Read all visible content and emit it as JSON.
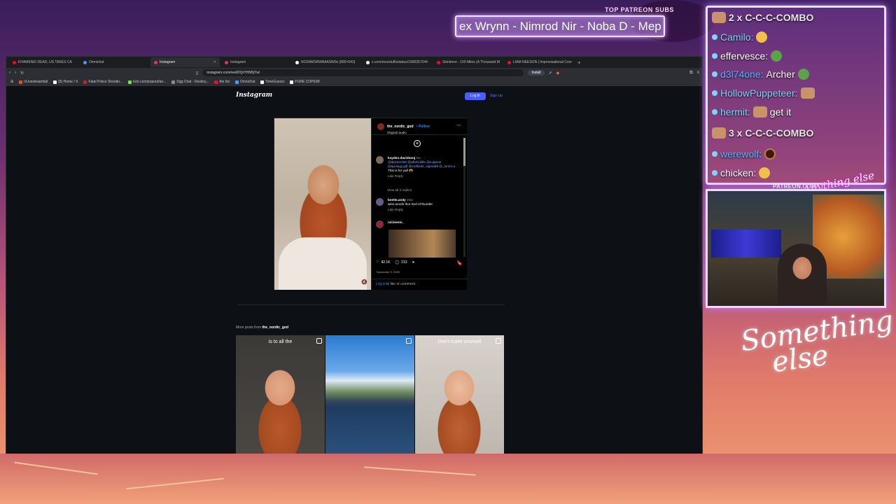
{
  "overlay": {
    "patreon_header": "TOP PATREON SUBS",
    "patreon_ticker": "ex Wrynn - Nimrod Nir - Noba D - Mep",
    "patreon_url": "PATREON.COM/",
    "anything_text": "Anything else",
    "signature_line1": "Something",
    "signature_line2": "else"
  },
  "browser": {
    "tabs": [
      {
        "label": "KHAMENEI DEAD, US TAKES CA",
        "color": "#ff0033"
      },
      {
        "label": "Omnichat",
        "color": "#3aa0ff"
      },
      {
        "label": "Instagram",
        "color": "#e1306c",
        "active": true
      },
      {
        "label": "Instagram",
        "color": "#e1306c"
      },
      {
        "label": "NCRAMSRWAAASW0s (890×543)",
        "color": "#ffffff"
      },
      {
        "label": "x.com/rezzstuffs/status/1990357244",
        "color": "#ffffff"
      },
      {
        "label": "Skinlerne - 100 Miles (A Thousand M",
        "color": "#ff0033"
      },
      {
        "label": "LIAM NEESON | Improvisational Com",
        "color": "#ff0033"
      }
    ],
    "new_tab_icon": "+",
    "url": "instagram.com/reel/DQrYHN5jYw/",
    "install_label": "Install",
    "bookmarks": [
      {
        "label": "r/Livestreamfail",
        "color": "#ff4500"
      },
      {
        "label": "(5) Home / X",
        "color": "#ffffff"
      },
      {
        "label": "Fatal Police Shootin...",
        "color": "#ff0033"
      },
      {
        "label": "kick.com/popout/an...",
        "color": "#53fc18"
      },
      {
        "label": "Dgg Chat - Destiny...",
        "color": "#8a8a8a"
      },
      {
        "label": "the list",
        "color": "#ff0033"
      },
      {
        "label": "Omnichat",
        "color": "#3aa0ff"
      },
      {
        "label": "TimeGuessr",
        "color": "#ffffff"
      },
      {
        "label": "PURE COPIUM",
        "color": "#ffffff"
      }
    ]
  },
  "instagram": {
    "logo": "Instagram",
    "login_label": "Log In",
    "signup_label": "Sign Up",
    "post": {
      "username": "the_nordic_god",
      "follow": "• Follow",
      "audio": "Original audio",
      "comments": [
        {
          "user": "kayden.davidsonj",
          "time": "6w",
          "mentions": "@dp4mn320 @villvrickille @a.pipme @apology.gdl @cutflavle_sigma69 @_lorinn.a",
          "text": "This is for yall 🫶",
          "actions": "Like   Reply",
          "avatar_color": "#7a6b5a"
        },
        {
          "user": "beetle.andy",
          "time": "16w",
          "text": "wise words thor lord of thunder",
          "actions": "Like   Reply",
          "avatar_color": "#6a5a8a"
        },
        {
          "user": "ral.leenin_",
          "avatar_color": "#8a2a3a"
        }
      ],
      "view_replies": "View all 3 replies",
      "likes": "42.1K",
      "comments_count": "213",
      "date": "November 3, 2025",
      "login_prompt_link": "Log in",
      "login_prompt_rest": " to like or comment."
    },
    "more_posts_prefix": "More posts from ",
    "more_posts_user": "the_nordic_god",
    "grid": [
      {
        "caption": "is to all the"
      },
      {
        "caption": ""
      },
      {
        "caption": "Don't make yourself"
      }
    ]
  },
  "chat": {
    "messages": [
      {
        "user": "",
        "text": "2 x C-C-C-COMBO",
        "type": "combo"
      },
      {
        "user": "Camilo:",
        "text": "",
        "user_color": "#7ad6ff"
      },
      {
        "user": "effervesce:",
        "text": "",
        "user_color": "#ffffff"
      },
      {
        "user": "d3l74one:",
        "text": "Archer",
        "user_color": "#5fb4ff"
      },
      {
        "user": "HollowPuppeteer:",
        "text": "",
        "user_color": "#7ad6ff"
      },
      {
        "user": "hermit:",
        "text": "get it",
        "user_color": "#7ad6ff"
      },
      {
        "user": "",
        "text": "3 x C-C-C-COMBO",
        "type": "combo"
      },
      {
        "user": "werewolf:",
        "text": "",
        "user_color": "#5fb4ff"
      },
      {
        "user": "chicken:",
        "text": "",
        "user_color": "#ffffff"
      }
    ]
  }
}
